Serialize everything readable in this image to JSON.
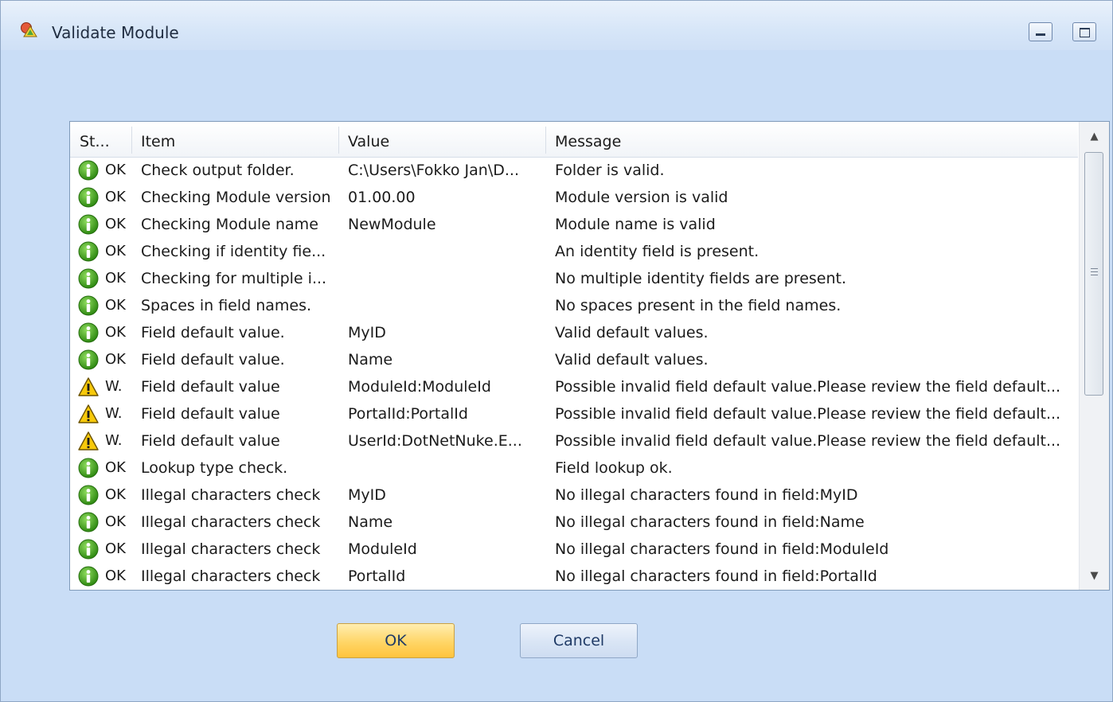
{
  "window": {
    "title": "Validate Module"
  },
  "grid": {
    "columns": [
      "St...",
      "Item",
      "Value",
      "Message"
    ],
    "rows": [
      {
        "status_type": "info",
        "status": "OK",
        "item": "Check output folder.",
        "value": "C:\\Users\\Fokko Jan\\D...",
        "message": "Folder is valid."
      },
      {
        "status_type": "info",
        "status": "OK",
        "item": "Checking Module version",
        "value": "01.00.00",
        "message": "Module version is valid"
      },
      {
        "status_type": "info",
        "status": "OK",
        "item": "Checking Module name",
        "value": "NewModule",
        "message": "Module name is valid"
      },
      {
        "status_type": "info",
        "status": "OK",
        "item": "Checking if identity fie...",
        "value": "",
        "message": "An identity field is present."
      },
      {
        "status_type": "info",
        "status": "OK",
        "item": "Checking for multiple i...",
        "value": "",
        "message": "No multiple identity fields are present."
      },
      {
        "status_type": "info",
        "status": "OK",
        "item": "Spaces in field names.",
        "value": "",
        "message": "No spaces present in the field names."
      },
      {
        "status_type": "info",
        "status": "OK",
        "item": "Field default value.",
        "value": "MyID",
        "message": "Valid default values."
      },
      {
        "status_type": "info",
        "status": "OK",
        "item": "Field default value.",
        "value": "Name",
        "message": "Valid default values."
      },
      {
        "status_type": "warning",
        "status": "W.",
        "item": "Field default value",
        "value": "ModuleId:ModuleId",
        "message": "Possible invalid field default value.Please review the field default..."
      },
      {
        "status_type": "warning",
        "status": "W.",
        "item": "Field default value",
        "value": "PortalId:PortalId",
        "message": "Possible invalid field default value.Please review the field default..."
      },
      {
        "status_type": "warning",
        "status": "W.",
        "item": "Field default value",
        "value": "UserId:DotNetNuke.E...",
        "message": "Possible invalid field default value.Please review the field default..."
      },
      {
        "status_type": "info",
        "status": "OK",
        "item": "Lookup type check.",
        "value": "",
        "message": "Field lookup ok."
      },
      {
        "status_type": "info",
        "status": "OK",
        "item": "Illegal characters check",
        "value": "MyID",
        "message": "No illegal characters found in field:MyID"
      },
      {
        "status_type": "info",
        "status": "OK",
        "item": "Illegal characters check",
        "value": "Name",
        "message": "No illegal characters found in field:Name"
      },
      {
        "status_type": "info",
        "status": "OK",
        "item": "Illegal characters check",
        "value": "ModuleId",
        "message": "No illegal characters found in field:ModuleId"
      },
      {
        "status_type": "info",
        "status": "OK",
        "item": "Illegal characters check",
        "value": "PortalId",
        "message": "No illegal characters found in field:PortalId"
      }
    ]
  },
  "buttons": {
    "ok_label": "OK",
    "cancel_label": "Cancel"
  },
  "icons": {
    "app": "validate-module-icon",
    "info": "info-icon",
    "warning": "warning-icon",
    "minimize": "minimize-icon",
    "maximize": "maximize-icon"
  },
  "colors": {
    "window_background": "#c9ddf6",
    "info_green": "#3f9b1f",
    "warning_yellow": "#f5c400",
    "ok_button": "#ffd566"
  }
}
